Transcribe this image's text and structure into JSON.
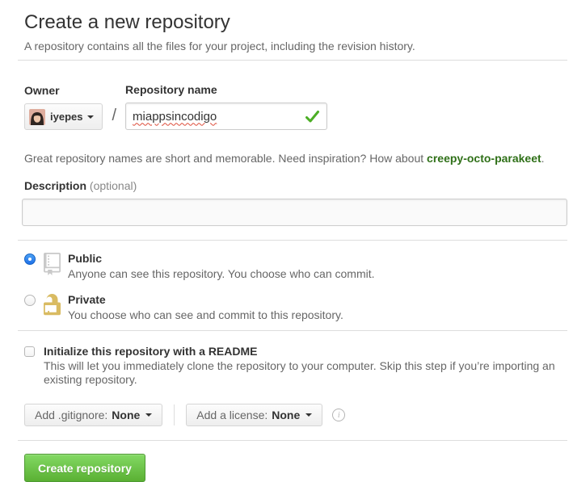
{
  "page": {
    "title": "Create a new repository",
    "subtitle": "A repository contains all the files for your project, including the revision history."
  },
  "owner": {
    "label": "Owner",
    "username": "iyepes",
    "separator": "/"
  },
  "repo_name": {
    "label": "Repository name",
    "value": "miappsincodigo"
  },
  "suggestion": {
    "text_before": "Great repository names are short and memorable. Need inspiration? How about ",
    "suggested_name": "creepy-octo-parakeet",
    "text_after": "."
  },
  "description": {
    "label": "Description",
    "optional": "(optional)",
    "value": ""
  },
  "visibility": {
    "public": {
      "label": "Public",
      "description": "Anyone can see this repository. You choose who can commit.",
      "selected": true
    },
    "private": {
      "label": "Private",
      "description": "You choose who can see and commit to this repository.",
      "selected": false
    }
  },
  "readme": {
    "label": "Initialize this repository with a README",
    "description": "This will let you immediately clone the repository to your computer. Skip this step if you’re importing an existing repository.",
    "checked": false
  },
  "options": {
    "gitignore_label": "Add .gitignore:",
    "gitignore_value": "None",
    "license_label": "Add a license:",
    "license_value": "None"
  },
  "actions": {
    "create_label": "Create repository"
  },
  "icons": {
    "info_glyph": "i"
  },
  "colors": {
    "accent_green": "#5ab033",
    "suggestion_green": "#2f7018",
    "check_green": "#4cae25",
    "radio_blue": "#1e6fe8",
    "lock_gold": "#d9bb62",
    "repo_icon_gray": "#c9c9c9"
  }
}
